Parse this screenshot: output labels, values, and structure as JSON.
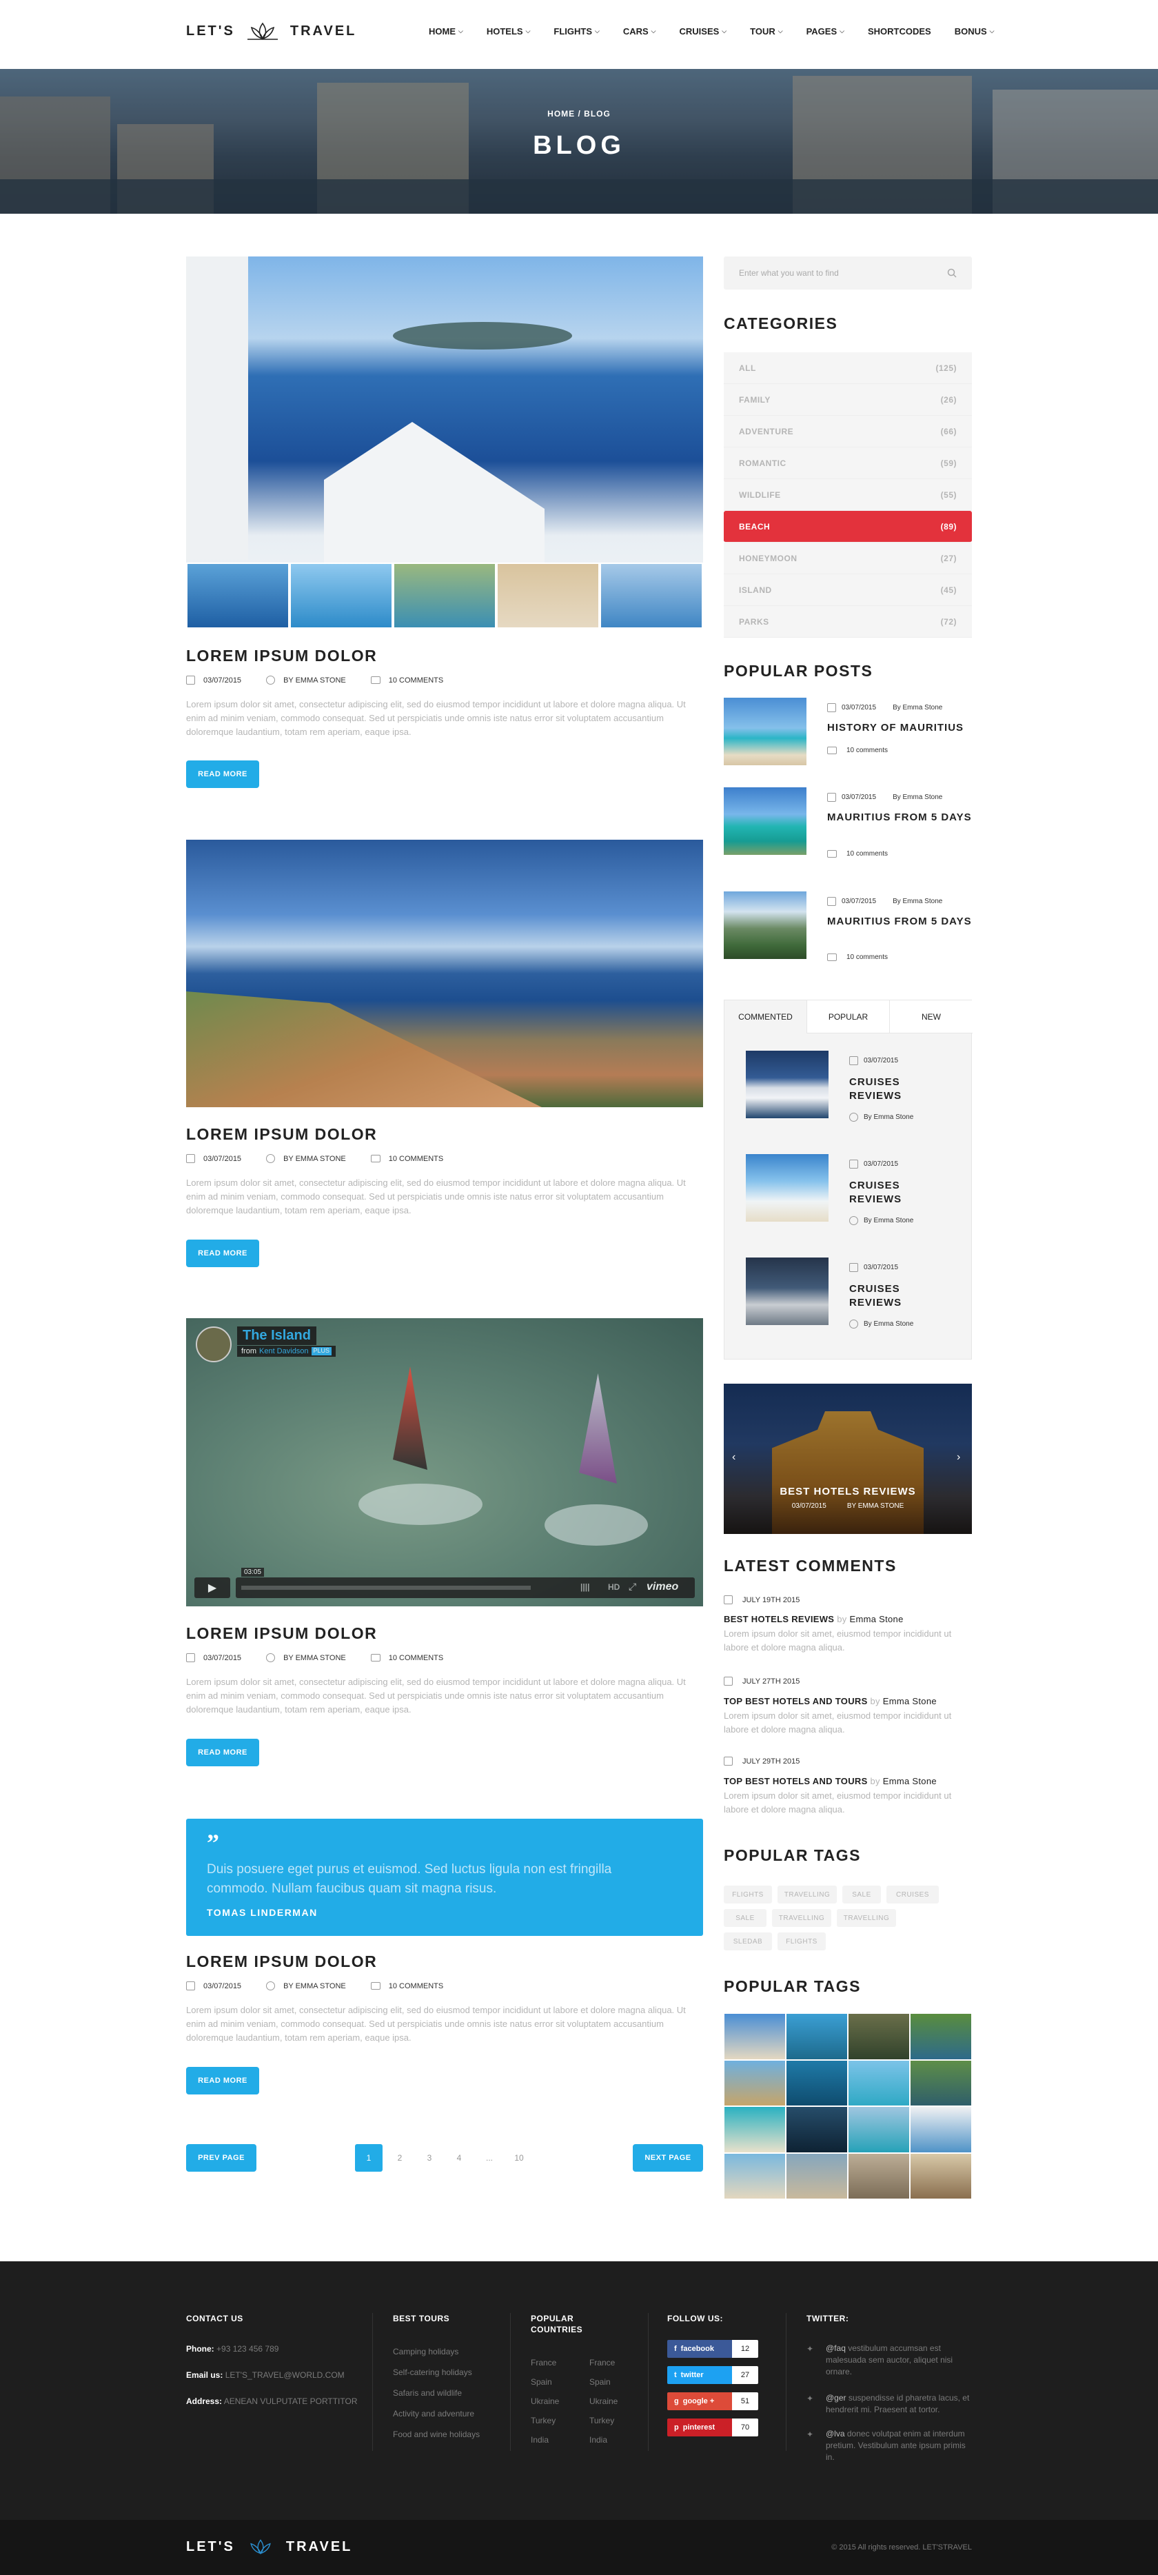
{
  "header": {
    "logo_left": "LET'S",
    "logo_right": "TRAVEL",
    "nav": [
      {
        "label": "HOME",
        "has_dropdown": true
      },
      {
        "label": "HOTELS",
        "has_dropdown": true
      },
      {
        "label": "FLIGHTS",
        "has_dropdown": true
      },
      {
        "label": "CARS",
        "has_dropdown": true
      },
      {
        "label": "CRUISES",
        "has_dropdown": true
      },
      {
        "label": "TOUR",
        "has_dropdown": true
      },
      {
        "label": "PAGES",
        "has_dropdown": true
      },
      {
        "label": "SHORTCODES",
        "has_dropdown": false
      },
      {
        "label": "BONUS",
        "has_dropdown": true
      }
    ]
  },
  "hero": {
    "breadcrumb": "HOME / BLOG",
    "title": "BLOG"
  },
  "posts": [
    {
      "title": "LOREM IPSUM DOLOR",
      "date": "03/07/2015",
      "author": "BY EMMA STONE",
      "comments": "10 COMMENTS",
      "excerpt": "Lorem ipsum dolor sit amet, consectetur adipiscing elit, sed do eiusmod tempor incididunt ut labore et dolore magna aliqua. Ut enim ad minim veniam, commodo consequat. Sed ut perspiciatis unde omnis iste natus error sit voluptatem accusantium doloremque laudantium, totam rem aperiam, eaque ipsa.",
      "button": "READ MORE"
    },
    {
      "title": "LOREM IPSUM DOLOR",
      "date": "03/07/2015",
      "author": "BY EMMA STONE",
      "comments": "10 COMMENTS",
      "excerpt": "Lorem ipsum dolor sit amet, consectetur adipiscing elit, sed do eiusmod tempor incididunt ut labore et dolore magna aliqua. Ut enim ad minim veniam, commodo consequat. Sed ut perspiciatis unde omnis iste natus error sit voluptatem accusantium doloremque laudantium, totam rem aperiam, eaque ipsa.",
      "button": "READ MORE"
    },
    {
      "title": "LOREM IPSUM DOLOR",
      "date": "03/07/2015",
      "author": "BY EMMA STONE",
      "comments": "10 COMMENTS",
      "excerpt": "Lorem ipsum dolor sit amet, consectetur adipiscing elit, sed do eiusmod tempor incididunt ut labore et dolore magna aliqua. Ut enim ad minim veniam, commodo consequat. Sed ut perspiciatis unde omnis iste natus error sit voluptatem accusantium doloremque laudantium, totam rem aperiam, eaque ipsa.",
      "button": "READ MORE"
    },
    {
      "title": "LOREM IPSUM DOLOR",
      "date": "03/07/2015",
      "author": "BY EMMA STONE",
      "comments": "10 COMMENTS",
      "excerpt": "Lorem ipsum dolor sit amet, consectetur adipiscing elit, sed do eiusmod tempor incididunt ut labore et dolore magna aliqua. Ut enim ad minim veniam, commodo consequat. Sed ut perspiciatis unde omnis iste natus error sit voluptatem accusantium doloremque laudantium, totam rem aperiam, eaque ipsa.",
      "button": "READ MORE"
    }
  ],
  "video": {
    "title": "The Island",
    "from": "from",
    "author": "Kent Davidson",
    "badge": "PLUS",
    "time": "03:05",
    "brand": "vimeo",
    "hd": "HD"
  },
  "quote": {
    "text": "Duis posuere eget purus et euismod. Sed luctus ligula non est fringilla commodo. Nullam faucibus quam sit magna risus.",
    "author": "TOMAS LINDERMAN"
  },
  "pagination": {
    "prev": "PREV PAGE",
    "next": "NEXT PAGE",
    "pages": [
      "1",
      "2",
      "3",
      "4",
      "...",
      "10"
    ],
    "current": "1"
  },
  "sidebar": {
    "search_placeholder": "Enter what you want to find",
    "categories_title": "CATEGORIES",
    "categories": [
      {
        "name": "ALL",
        "count": "(125)"
      },
      {
        "name": "FAMILY",
        "count": "(26)"
      },
      {
        "name": "ADVENTURE",
        "count": "(66)"
      },
      {
        "name": "ROMANTIC",
        "count": "(59)"
      },
      {
        "name": "WILDLIFE",
        "count": "(55)"
      },
      {
        "name": "BEACH",
        "count": "(89)",
        "active": true
      },
      {
        "name": "HONEYMOON",
        "count": "(27)"
      },
      {
        "name": "ISLAND",
        "count": "(45)"
      },
      {
        "name": "PARKS",
        "count": "(72)"
      }
    ],
    "popular_posts_title": "POPULAR POSTS",
    "popular_posts": [
      {
        "date": "03/07/2015",
        "author": "By Emma Stone",
        "title": "HISTORY OF MAURITIUS",
        "comments": "10 comments"
      },
      {
        "date": "03/07/2015",
        "author": "By Emma Stone",
        "title": "MAURITIUS FROM 5 DAYS",
        "comments": "10 comments"
      },
      {
        "date": "03/07/2015",
        "author": "By Emma Stone",
        "title": "MAURITIUS FROM 5 DAYS",
        "comments": "10 comments"
      }
    ],
    "tabs": [
      "COMMENTED",
      "POPULAR",
      "NEW"
    ],
    "tab_posts": [
      {
        "date": "03/07/2015",
        "title": "CRUISES REVIEWS",
        "author": "By Emma Stone"
      },
      {
        "date": "03/07/2015",
        "title": "CRUISES REVIEWS",
        "author": "By Emma Stone"
      },
      {
        "date": "03/07/2015",
        "title": "CRUISES REVIEWS",
        "author": "By Emma Stone"
      }
    ],
    "hotel_banner": {
      "title": "BEST HOTELS REVIEWS",
      "date": "03/07/2015",
      "author": "BY EMMA STONE"
    },
    "latest_comments_title": "LATEST COMMENTS",
    "latest_comments": [
      {
        "date": "JULY 19TH 2015",
        "title": "BEST HOTELS REVIEWS",
        "by": "by",
        "author": "Emma Stone",
        "text": "Lorem ipsum dolor sit amet, eiusmod tempor incididunt ut labore et dolore magna aliqua."
      },
      {
        "date": "JULY 27TH 2015",
        "title": "TOP BEST HOTELS AND TOURS",
        "by": "by",
        "author": "Emma Stone",
        "text": "Lorem ipsum dolor sit amet, eiusmod tempor incididunt ut labore et dolore magna aliqua."
      },
      {
        "date": "JULY 29TH 2015",
        "title": "TOP BEST HOTELS AND TOURS",
        "by": "by",
        "author": "Emma Stone",
        "text": "Lorem ipsum dolor sit amet, eiusmod tempor incididunt ut labore et dolore magna aliqua."
      }
    ],
    "popular_tags_title": "POPULAR TAGS",
    "tags": [
      "FLIGHTS",
      "TRAVELLING",
      "SALE",
      "CRUISES",
      "SALE",
      "TRAVELLING",
      "TRAVELLING",
      "SLEDAB",
      "FLIGHTS"
    ],
    "gallery_title": "POPULAR TAGS"
  },
  "footer": {
    "contact_title": "CONTACT US",
    "phone_label": "Phone:",
    "phone": "+93 123 456 789",
    "email_label": "Email us:",
    "email": "LET'S_TRAVEL@WORLD.COM",
    "address_label": "Address:",
    "address": "AENEAN VULPUTATE PORTTITOR",
    "best_tours_title": "BEST TOURS",
    "best_tours": [
      "Camping holidays",
      "Self-catering holidays",
      "Safaris and wildlife",
      "Activity and adventure",
      "Food and wine holidays"
    ],
    "countries_title": "POPULAR COUNTRIES",
    "countries_a": [
      "France",
      "Spain",
      "Ukraine",
      "Turkey",
      "India"
    ],
    "countries_b": [
      "France",
      "Spain",
      "Ukraine",
      "Turkey",
      "India"
    ],
    "follow_title": "FOLLOW US:",
    "social": [
      {
        "name": "facebook",
        "count": "12",
        "color": "#3b5998"
      },
      {
        "name": "twitter",
        "count": "27",
        "color": "#1da1f2"
      },
      {
        "name": "google +",
        "count": "51",
        "color": "#dd4b39"
      },
      {
        "name": "pinterest",
        "count": "70",
        "color": "#cb2027"
      }
    ],
    "twitter_title": "TWITTER:",
    "tweets": [
      {
        "handle": "@faq",
        "text": "vestibulum accumsan est malesuada sem auctor, aliquet nisi ornare."
      },
      {
        "handle": "@ger",
        "text": "suspendisse id pharetra lacus, et hendrerit mi. Praesent at tortor."
      },
      {
        "handle": "@lva",
        "text": "donec volutpat enim at interdum pretium. Vestibulum ante ipsum primis in."
      }
    ],
    "logo_left": "LET'S",
    "logo_right": "TRAVEL",
    "copyright": "© 2015 All rights reserved. LET'STRAVEL"
  },
  "colors": {
    "accent": "#22ace7",
    "active_category": "#e3323c",
    "footer_bg": "#1e1e1e"
  }
}
